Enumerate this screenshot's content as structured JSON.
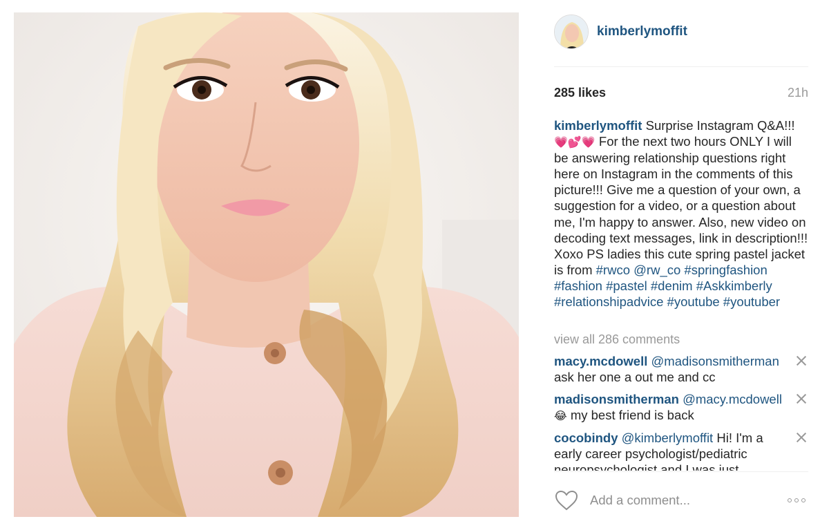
{
  "post": {
    "username": "kimberlymoffit",
    "likes": "285 likes",
    "time": "21h",
    "caption": {
      "username": "kimberlymoffit",
      "text_1": "Surprise Instagram Q&A!!!",
      "emoji": "💗💕💗",
      "text_2": "For the next two hours ONLY I will be answering relationship questions right here on Instagram in the comments of this picture!!! Give me a question of your own, a suggestion for a video, or a question about me, I'm happy to answer. Also, new video on decoding text messages, link in description!!! Xoxo PS ladies this cute spring pastel jacket is from",
      "tags": [
        "#rwco",
        "@rw_co",
        "#springfashion",
        "#fashion",
        "#pastel",
        "#denim",
        "#Askkimberly",
        "#relationshipadvice",
        "#youtube",
        "#youtuber"
      ]
    },
    "view_all": "view all 286 comments",
    "comments": [
      {
        "user": "macy.mcdowell",
        "mention": "@madisonsmitherman",
        "emoji": "",
        "text": "ask her one a out me and cc"
      },
      {
        "user": "madisonsmitherman",
        "mention": "@macy.mcdowell",
        "emoji": "😂",
        "text": "my best friend is back"
      },
      {
        "user": "cocobindy",
        "mention": "@kimberlymoffit",
        "emoji": "",
        "text": "Hi! I'm a early career psychologist/pediatric neuropsychologist and I was just"
      }
    ],
    "add_comment_placeholder": "Add a comment...",
    "icons": {
      "like": "heart-icon",
      "more": "more-options-icon",
      "delete": "close-icon"
    },
    "colors": {
      "link": "#1f5580",
      "muted": "#999999"
    }
  }
}
